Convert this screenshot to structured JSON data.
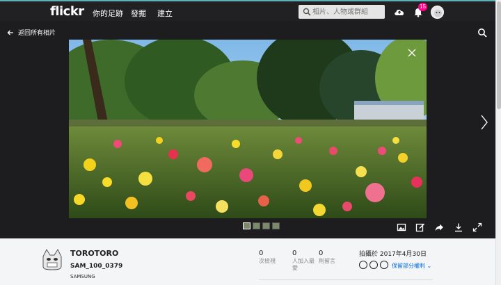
{
  "topbar": {
    "brand": "flickr",
    "nav": [
      "你的足跡",
      "發掘",
      "建立"
    ],
    "search_placeholder": "相片、人物或群組",
    "notifications_count": "15",
    "upload_icon": "cloud-upload-icon",
    "bell_icon": "bell-icon"
  },
  "viewer": {
    "back_label": "返回所有相片",
    "thumbnail_count": 4
  },
  "info": {
    "owner": "TOROTORO",
    "title": "SAM_100_0379",
    "description": "SAMSUNG",
    "stats": [
      {
        "num": "0",
        "label": "次檢視"
      },
      {
        "num": "0",
        "label": "人加入最愛"
      },
      {
        "num": "0",
        "label": "則留言"
      }
    ],
    "taken": "拍攝於 2017年4月30日",
    "license": "保留部分權利"
  },
  "colors": {
    "topbar_bg": "#212124",
    "accent": "#5fb0b7",
    "badge": "#ff0084",
    "link": "#006add"
  }
}
